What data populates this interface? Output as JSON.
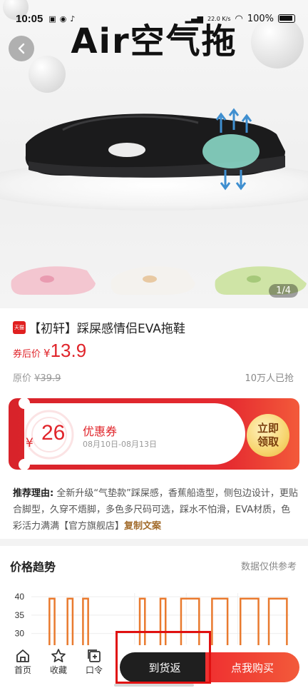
{
  "status_bar": {
    "time": "10:05",
    "network": "22.0 K/s",
    "battery": "100%"
  },
  "hero": {
    "title": "Air空气拖",
    "page_indicator": "1/4"
  },
  "product": {
    "shop_badge": "天猫",
    "title": "【初轩】踩屎感情侣EVA拖鞋",
    "price_label": "券后价",
    "currency": "¥",
    "price": "13.9",
    "original_label": "原价",
    "original_price": "¥39.9",
    "sold": "10万人已抢"
  },
  "coupon": {
    "currency": "¥",
    "amount": "26",
    "name": "优惠券",
    "date_range": "08月10日-08月13日",
    "claim_line1": "立即",
    "claim_line2": "领取"
  },
  "recommendation": {
    "label": "推荐理由:",
    "text": "全新升级“气垫款”踩屎感，香蕉船造型，侧包边设计，更贴合脚型，久穿不焐脚，多色多尺码可选，踩水不怕滑，EVA材质，色彩活力满满【官方旗舰店】",
    "copy_link": "复制文案"
  },
  "price_trend": {
    "title": "价格趋势",
    "note": "数据仅供参考"
  },
  "chart_data": {
    "type": "line",
    "y_ticks": [
      40,
      35,
      30
    ],
    "ylim": [
      27,
      41
    ],
    "grid": true,
    "series": [
      {
        "color": "#e97a2e",
        "pulses": [
          [
            0.07,
            0.09
          ],
          [
            0.14,
            0.16
          ],
          [
            0.2,
            0.22
          ],
          [
            0.42,
            0.44
          ],
          [
            0.5,
            0.52
          ],
          [
            0.58,
            0.65
          ],
          [
            0.7,
            0.76
          ],
          [
            0.81,
            0.88
          ],
          [
            0.92,
            0.99
          ]
        ],
        "high": 39.5,
        "low": 27
      }
    ]
  },
  "bottom_bar": {
    "home": "首页",
    "favorite": "收藏",
    "code": "口令",
    "notify": "到货返",
    "buy": "点我购买"
  }
}
